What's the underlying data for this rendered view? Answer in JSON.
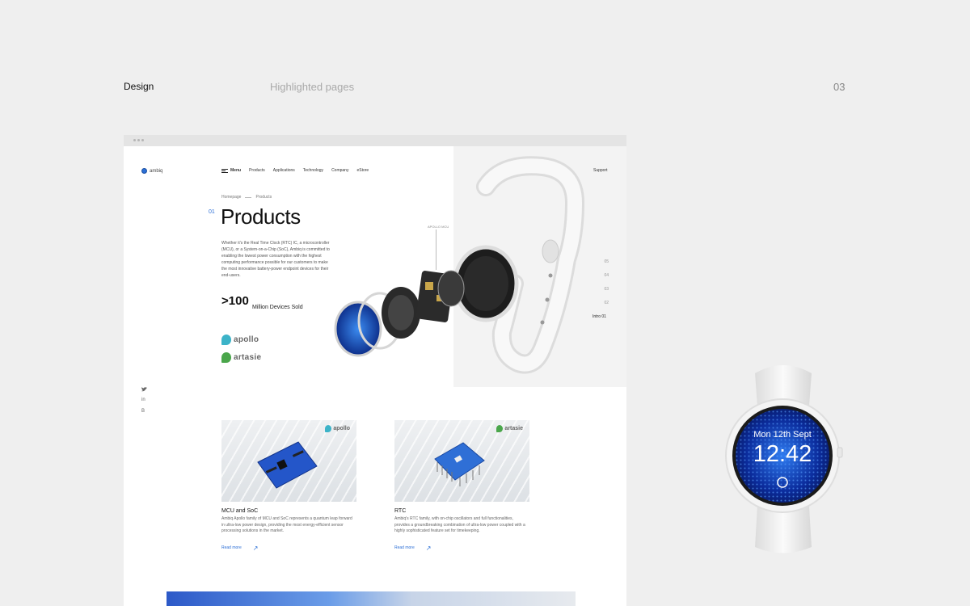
{
  "presentation": {
    "section": "Design",
    "subtitle": "Highlighted pages",
    "page_number": "03"
  },
  "site": {
    "logo_text": "ambiq",
    "nav": {
      "menu_label": "Menu",
      "items": [
        "Products",
        "Applications",
        "Technology",
        "Company",
        "eStore"
      ],
      "support": "Support"
    },
    "breadcrumb": {
      "home": "Homepage",
      "current": "Products"
    },
    "hero": {
      "section_number": "01",
      "title": "Products",
      "intro": "Whether it's the Real Time Clock (RTC) IC, a microcontroller (MCU), or a System-on-a-Chip (SoC), Ambiq is committed to enabling the lowest power consumption with the highest computing performance possible for our customers to make the most innovative battery-power endpoint devices for their end-users.",
      "stat_value": ">100",
      "stat_label": "Million Devices Sold",
      "callout": "APOLLO MCU"
    },
    "brands": [
      {
        "name": "apollo",
        "color": "#3cb3c8"
      },
      {
        "name": "artasie",
        "color": "#4aa64b"
      }
    ],
    "social": [
      "twitter-icon",
      "linkedin-icon",
      "blog-icon"
    ],
    "pager": [
      "05",
      "04",
      "03",
      "02"
    ],
    "pager_active": {
      "label": "Intro",
      "number": "01"
    },
    "cards": [
      {
        "badge": "apollo",
        "title": "MCU and SoC",
        "desc": "Ambiq Apollo family of MCU and SoC represents a quantum leap forward in ultra-low power design, providing the most energy-efficient sensor processing solutions in the market.",
        "link": "Read more"
      },
      {
        "badge": "artasie",
        "title": "RTC",
        "desc": "Ambiq's RTC family, with on-chip oscillators and full functionalities, provides a groundbreaking combination of ultra-low power coupled with a highly sophisticated feature set for timekeeping.",
        "link": "Read more"
      }
    ]
  },
  "watch_face": {
    "date": "Mon 12th Sept",
    "time": "12:42"
  },
  "colors": {
    "accent": "#2c6fd6",
    "background": "#efefef",
    "apollo": "#3cb3c8",
    "artasie": "#4aa64b"
  }
}
